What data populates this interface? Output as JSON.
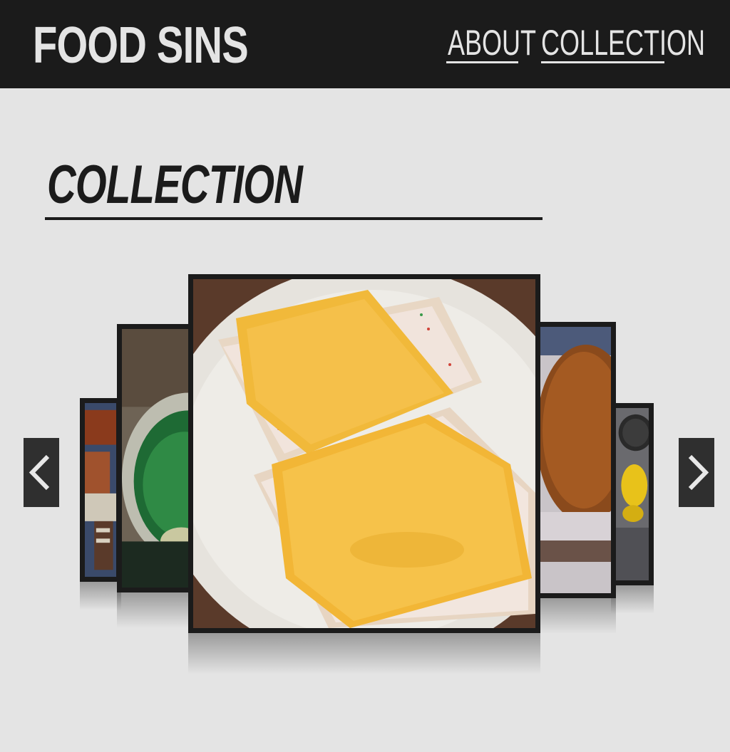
{
  "site": {
    "logo": "FOOD SINS",
    "nav": [
      {
        "label": "ABOUT"
      },
      {
        "label": "COLLECTION"
      }
    ]
  },
  "page": {
    "section_title": "COLLECTION"
  },
  "carousel": {
    "prev_icon": "chevron-left-icon",
    "next_icon": "chevron-right-icon",
    "slides": [
      {
        "name": "hot-dog-candy-photo"
      },
      {
        "name": "green-jello-bowl-photo"
      },
      {
        "name": "pop-tarts-with-cheese-photo"
      },
      {
        "name": "fried-patty-photo"
      },
      {
        "name": "yellow-figure-photo"
      }
    ],
    "active_index": 2
  },
  "colors": {
    "header_bg": "#1b1b1b",
    "page_bg": "#e4e4e4",
    "text_light": "#e4e4e4",
    "text_dark": "#1b1b1b",
    "arrow_bg": "#2f2f2f"
  }
}
